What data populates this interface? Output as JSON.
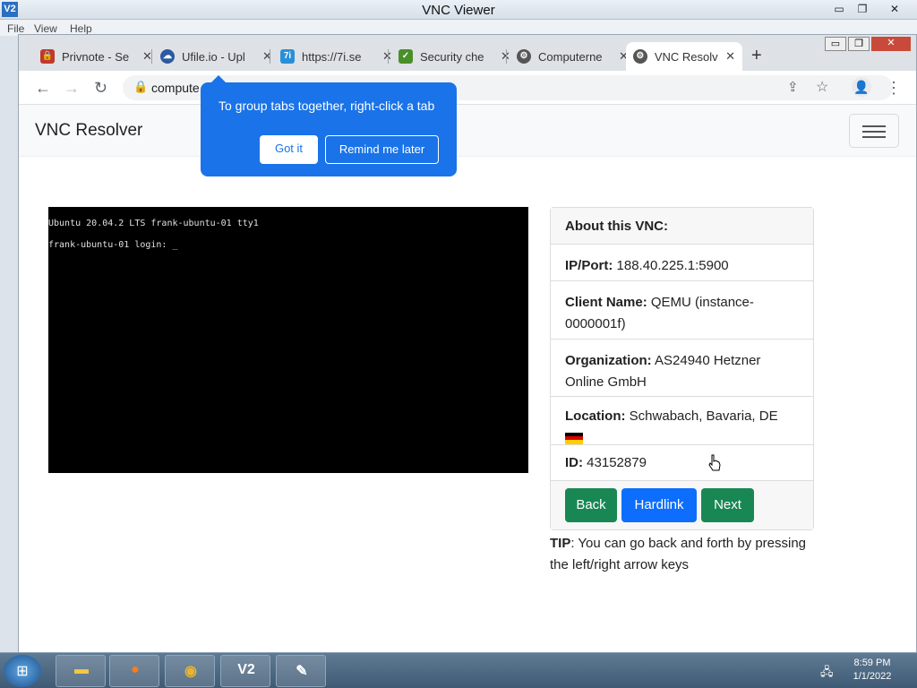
{
  "vnc": {
    "title": "VNC Viewer",
    "logo": "V2",
    "menu": [
      "File",
      "View",
      "Help"
    ]
  },
  "browser": {
    "tabs": [
      {
        "label": "Privnote - Se",
        "icon": "privnote-icon",
        "color": "#c0392b"
      },
      {
        "label": "Ufile.io - Upl",
        "icon": "ufile-icon",
        "color": "#2c5aa0"
      },
      {
        "label": "https://7i.se",
        "icon": "7i-icon",
        "color": "#2a8fd8"
      },
      {
        "label": "Security che",
        "icon": "security-check-icon",
        "color": "#4a8f2a"
      },
      {
        "label": "Computerne",
        "icon": "computer-icon",
        "color": "#555555"
      },
      {
        "label": "VNC Resolve",
        "icon": "vnc-resolver-icon",
        "color": "#555555"
      }
    ],
    "url": "compute",
    "popover": {
      "text": "To group tabs together, right-click a tab",
      "got_it": "Got it",
      "remind": "Remind me later"
    }
  },
  "page": {
    "brand": "VNC Resolver",
    "screen_lines": [
      "Ubuntu 20.04.2 LTS frank-ubuntu-01 tty1",
      "frank-ubuntu-01 login: _"
    ],
    "card": {
      "header": "About this VNC:",
      "ip_label": "IP/Port:",
      "ip_value": "188.40.225.1:5900",
      "client_label": "Client Name:",
      "client_value": "QEMU (instance-0000001f)",
      "org_label": "Organization:",
      "org_value": "AS24940 Hetzner Online GmbH",
      "loc_label": "Location:",
      "loc_value": "Schwabach, Bavaria, DE",
      "id_label": "ID:",
      "id_value": "43152879"
    },
    "buttons": {
      "back": "Back",
      "hardlink": "Hardlink",
      "next": "Next"
    },
    "tip_label": "TIP",
    "tip_text": ": You can go back and forth by pressing the left/right arrow keys"
  },
  "taskbar": {
    "time": "8:59 PM",
    "date": "1/1/2022"
  }
}
